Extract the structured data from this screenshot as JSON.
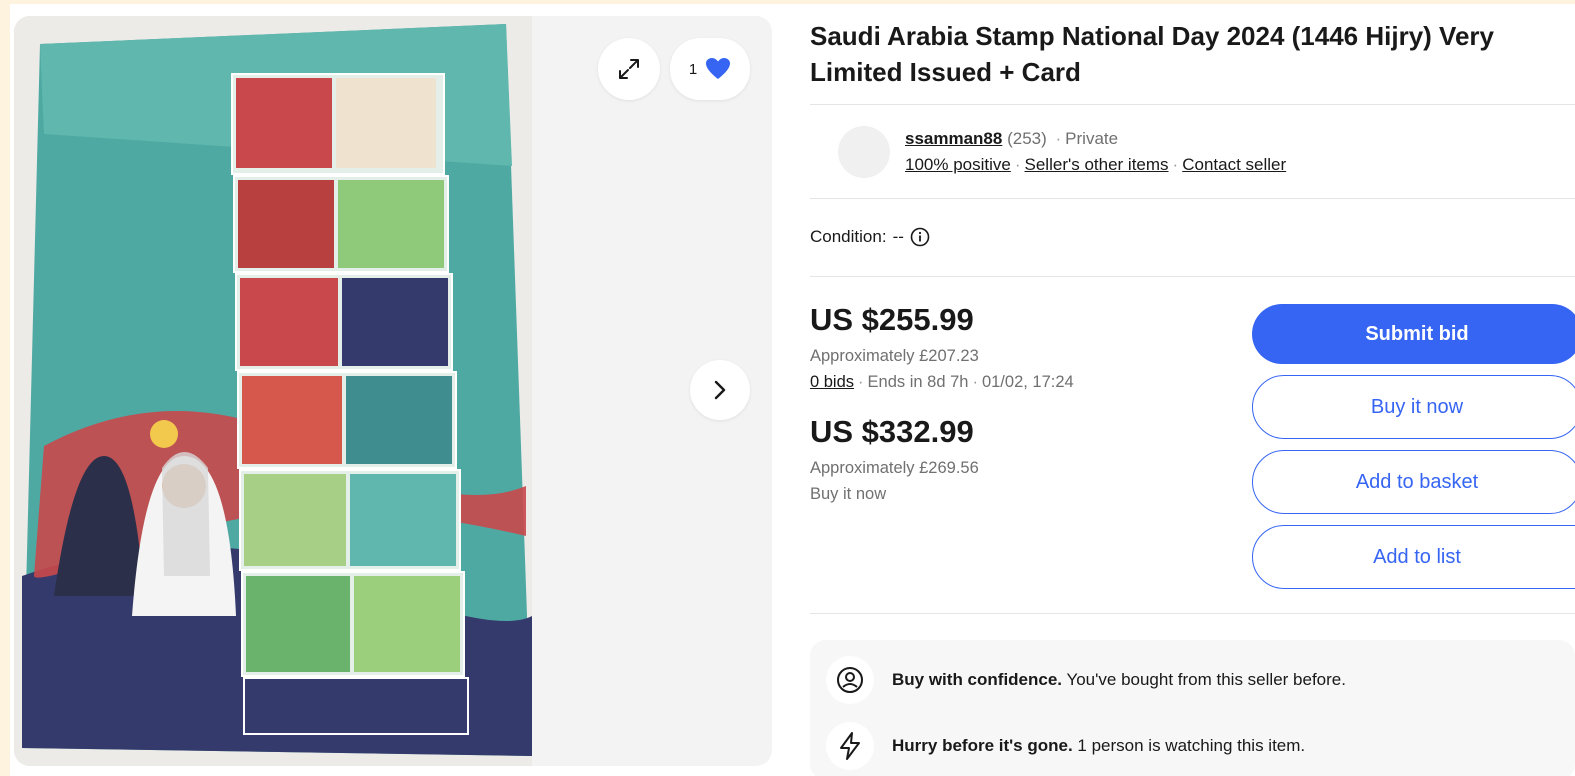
{
  "gallery": {
    "watch_count": "1",
    "expand_icon": "expand-icon",
    "heart_icon": "heart-icon",
    "next_icon": "chevron-right-icon",
    "heart_color": "#3665f3"
  },
  "listing": {
    "title_line1": "Saudi Arabia Stamp National Day 2024 (1446 Hijry) Very",
    "title_line2": "Limited Issued + Card"
  },
  "seller": {
    "name": "ssamman88",
    "rating_count": "(253)",
    "type": "Private",
    "feedback": "100% positive",
    "other_items": "Seller's other items",
    "contact": "Contact seller"
  },
  "condition": {
    "label": "Condition:",
    "value": "--",
    "info_icon": "info-icon"
  },
  "bid": {
    "price": "US $255.99",
    "approx": "Approximately £207.23",
    "bids": "0 bids",
    "ends": "Ends in 8d 7h",
    "end_date": "01/02, 17:24"
  },
  "buy_now": {
    "price": "US $332.99",
    "approx": "Approximately £269.56",
    "label": "Buy it now"
  },
  "buttons": {
    "submit_bid": "Submit bid",
    "buy_now": "Buy it now",
    "add_basket": "Add to basket",
    "add_list": "Add to list"
  },
  "confidence": {
    "row1_bold": "Buy with confidence.",
    "row1_text": "You've bought from this seller before.",
    "row2_bold": "Hurry before it's gone.",
    "row2_text": "1 person is watching this item."
  },
  "colors": {
    "accent": "#3665f3",
    "stamp_teal": "#4fa9a3",
    "stamp_navy": "#343a6b",
    "stamp_red": "#c9484b"
  }
}
